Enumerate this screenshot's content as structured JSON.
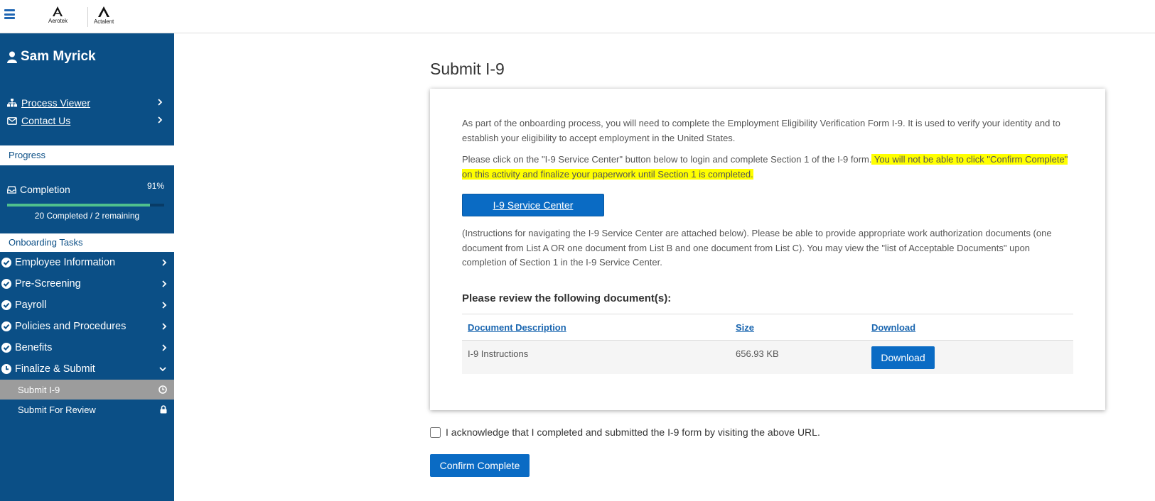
{
  "header": {
    "logo1": "Aerotek",
    "logo2": "Actalent"
  },
  "sidebar": {
    "user_name": "Sam Myrick",
    "links": [
      {
        "label": "Process Viewer",
        "icon": "sitemap-icon"
      },
      {
        "label": "Contact Us",
        "icon": "envelope-icon"
      }
    ],
    "progress_label": "Progress",
    "completion_label": "Completion",
    "completion_pct": "91%",
    "completion_value": 0.91,
    "completion_text": "20 Completed / 2 remaining",
    "tasks_label": "Onboarding Tasks",
    "tasks": [
      {
        "label": "Employee Information",
        "status": "done"
      },
      {
        "label": "Pre-Screening",
        "status": "done"
      },
      {
        "label": "Payroll",
        "status": "done"
      },
      {
        "label": "Policies and Procedures",
        "status": "done"
      },
      {
        "label": "Benefits",
        "status": "done"
      },
      {
        "label": "Finalize & Submit",
        "status": "in-progress"
      }
    ],
    "subtasks": [
      {
        "label": "Submit I-9",
        "icon": "clock-icon",
        "active": true
      },
      {
        "label": "Submit For Review",
        "icon": "lock-icon",
        "active": false
      }
    ]
  },
  "main": {
    "title": "Submit I-9",
    "para1": "As part of the onboarding process, you will need to complete the Employment Eligibility Verification Form I-9. It is used to verify your identity and to establish your eligibility to accept employment in the United States.",
    "para2_pre": "Please click on the \"I-9 Service Center\" button below to login and complete Section 1 of the I-9 form.",
    "para2_hl": " You will not be able to click \"Confirm Complete\" on this activity and finalize your paperwork until Section 1 is completed.",
    "service_button": "I-9 Service Center",
    "para3": "(Instructions for navigating the I-9 Service Center are attached below).  Please be able to provide appropriate work authorization documents (one document from List A OR one document from List B and one document from List C).  You may view the \"list of Acceptable Documents\" upon completion of Section 1 in the I-9 Service Center.",
    "review_heading": "Please review the following document(s):",
    "table": {
      "headers": [
        "Document Description",
        "Size",
        "Download"
      ],
      "rows": [
        {
          "description": "I-9 Instructions",
          "size": "656.93 KB",
          "button": "Download"
        }
      ]
    },
    "ack_label": "I acknowledge that I completed and submitted the I-9 form by visiting the above URL.",
    "confirm_button": "Confirm Complete"
  },
  "colors": {
    "sidebar_bg": "#0b4f86",
    "accent": "#0a6bc4",
    "highlight": "#ffff00",
    "progress": "#4fc08d"
  }
}
